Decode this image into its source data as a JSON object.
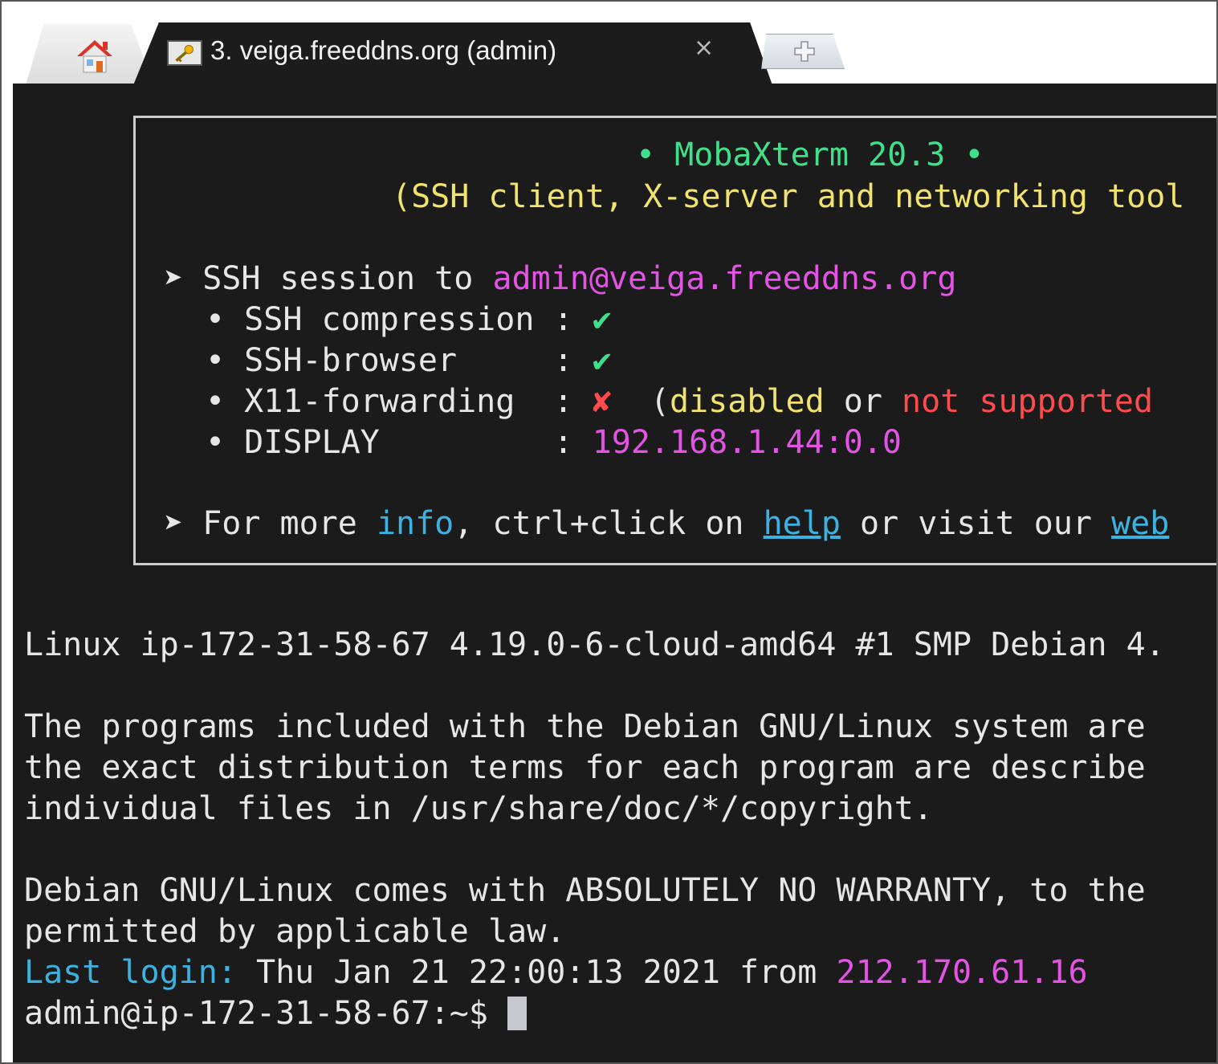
{
  "tabs": {
    "home_icon": "house-icon",
    "active": {
      "icon": "key-icon",
      "title": "3. veiga.freeddns.org (admin)",
      "close": "×"
    },
    "new_tab_icon": "plus-icon"
  },
  "banner": {
    "title": "• MobaXterm 20.3 •",
    "subtitle": "(SSH client, X-server and networking tool",
    "session_prefix": "SSH session to",
    "session_target": "admin@veiga.freeddns.org",
    "items": [
      {
        "label": "• SSH compression :",
        "value": "✔"
      },
      {
        "label": "• SSH-browser     :",
        "value": "✔"
      },
      {
        "label": "• X11-forwarding  :",
        "value": "✘"
      },
      {
        "label": "• DISPLAY         :",
        "value": "192.168.1.44:0.0"
      }
    ],
    "x11_note_open": "(",
    "x11_note_a": "disabled",
    "x11_note_or": "or",
    "x11_note_b": "not supported",
    "more_prefix": "For more",
    "more_info": "info",
    "more_mid": ", ctrl+click on",
    "more_help": "help",
    "more_or": "or visit our",
    "more_web": "web"
  },
  "output": {
    "line1": "Linux ip-172-31-58-67 4.19.0-6-cloud-amd64 #1 SMP Debian 4.",
    "line2": "The programs included with the Debian GNU/Linux system are",
    "line3": "the exact distribution terms for each program are describe",
    "line4": "individual files in /usr/share/doc/*/copyright.",
    "line5": "Debian GNU/Linux comes with ABSOLUTELY NO WARRANTY, to the",
    "line6": "permitted by applicable law.",
    "last_login_label": "Last login:",
    "last_login_date": "Thu Jan 21 22:00:13 2021 from",
    "last_login_ip": "212.170.61.16",
    "prompt": "admin@ip-172-31-58-67:~$"
  },
  "colors": {
    "terminal_bg": "#1b1b1b",
    "green": "#3fe08a",
    "yellow": "#f1e36c",
    "magenta": "#e454e4",
    "red": "#ff4b4b",
    "cyan": "#3bb2e0"
  }
}
